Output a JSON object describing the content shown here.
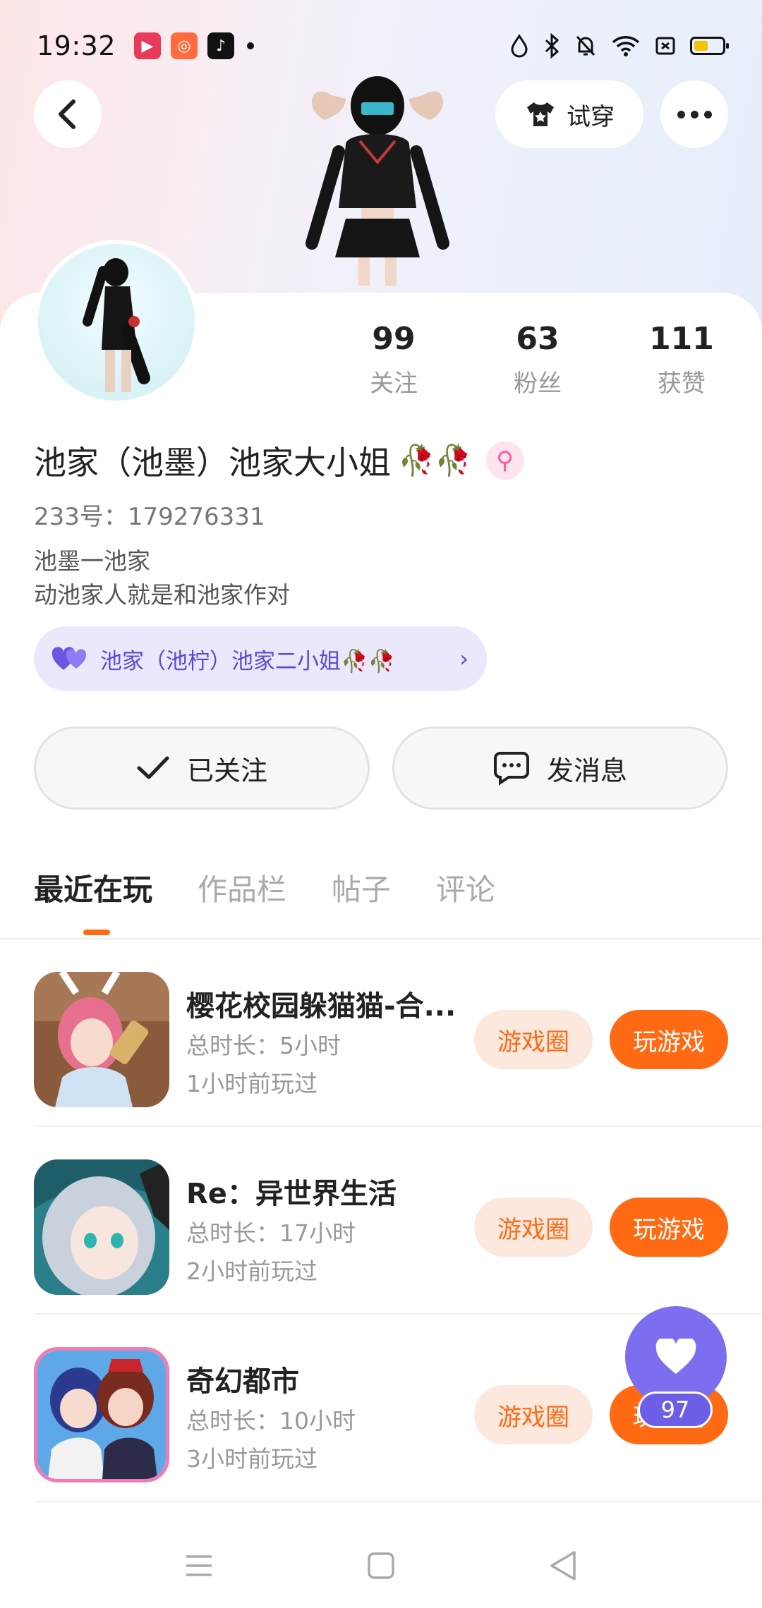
{
  "status_bar": {
    "time": "19:32",
    "notification_apps": [
      "video-app-icon",
      "kuaishou-icon",
      "tiktok-icon"
    ],
    "battery_level": 0.5
  },
  "header": {
    "try_on_label": "试穿"
  },
  "profile": {
    "stats": [
      {
        "value": "99",
        "label": "关注"
      },
      {
        "value": "63",
        "label": "粉丝"
      },
      {
        "value": "111",
        "label": "获赞"
      }
    ],
    "name": "池家（池墨）池家大小姐",
    "name_emoji": "🥀🥀",
    "gender_symbol": "⚲",
    "uid": "233号：179276331",
    "bio_line1": "池墨一池家",
    "bio_line2": "动池家人就是和池家作对",
    "relation_label": "池家（池柠）池家二小姐🥀🥀"
  },
  "actions": {
    "follow_label": "已关注",
    "message_label": "发消息"
  },
  "tabs": [
    "最近在玩",
    "作品栏",
    "帖子",
    "评论"
  ],
  "games": [
    {
      "title": "樱花校园躲猫猫-合...",
      "duration": "总时长：5小时",
      "last_played": "1小时前玩过",
      "circle_label": "游戏圈",
      "play_label": "玩游戏"
    },
    {
      "title": "Re：异世界生活",
      "duration": "总时长：17小时",
      "last_played": "2小时前玩过",
      "circle_label": "游戏圈",
      "play_label": "玩游戏"
    },
    {
      "title": "奇幻都市",
      "duration": "总时长：10小时",
      "last_played": "3小时前玩过",
      "circle_label": "游戏圈",
      "play_label": "玩游戏"
    }
  ],
  "fab": {
    "like_count": "97"
  },
  "colors": {
    "accent_orange": "#ff6a13",
    "accent_purple": "#7d6ef0",
    "chip_bg": "#ebe8fc"
  }
}
